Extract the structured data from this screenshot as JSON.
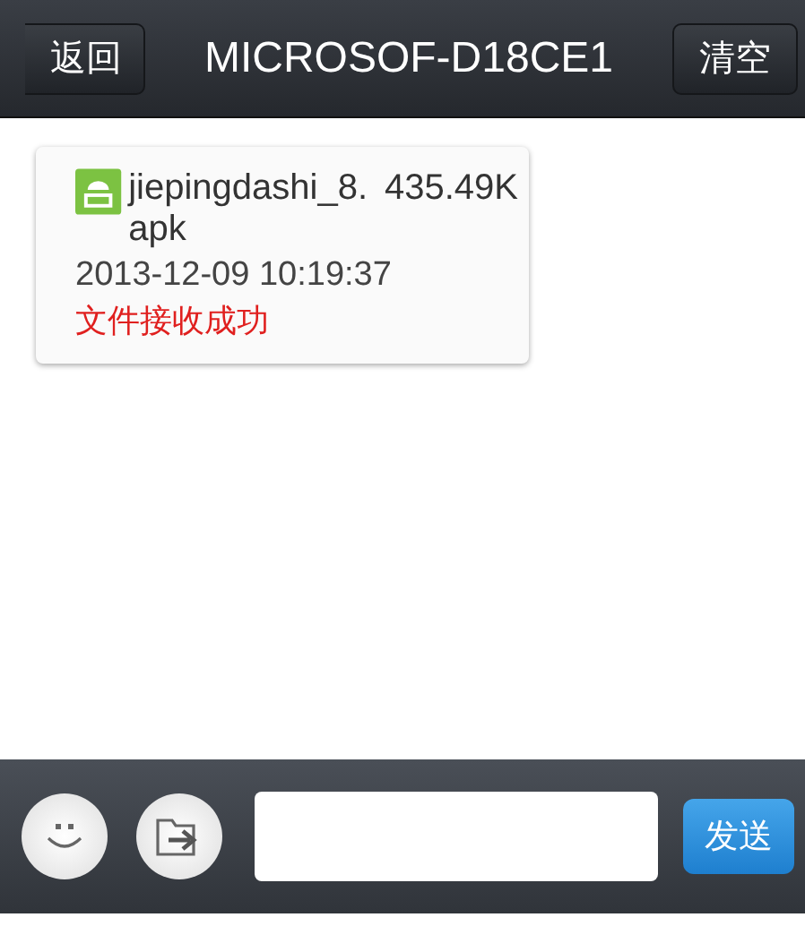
{
  "header": {
    "back_button": "返回",
    "title": "MICROSOF-D18CE1",
    "clear_button": "清空"
  },
  "messages": [
    {
      "kind": "file",
      "file_name": "jiepingdashi_8.apk",
      "size": "435.49K",
      "time": "2013-12-09 10:19:37",
      "status": "文件接收成功"
    }
  ],
  "input_bar": {
    "send_button": "发送"
  }
}
